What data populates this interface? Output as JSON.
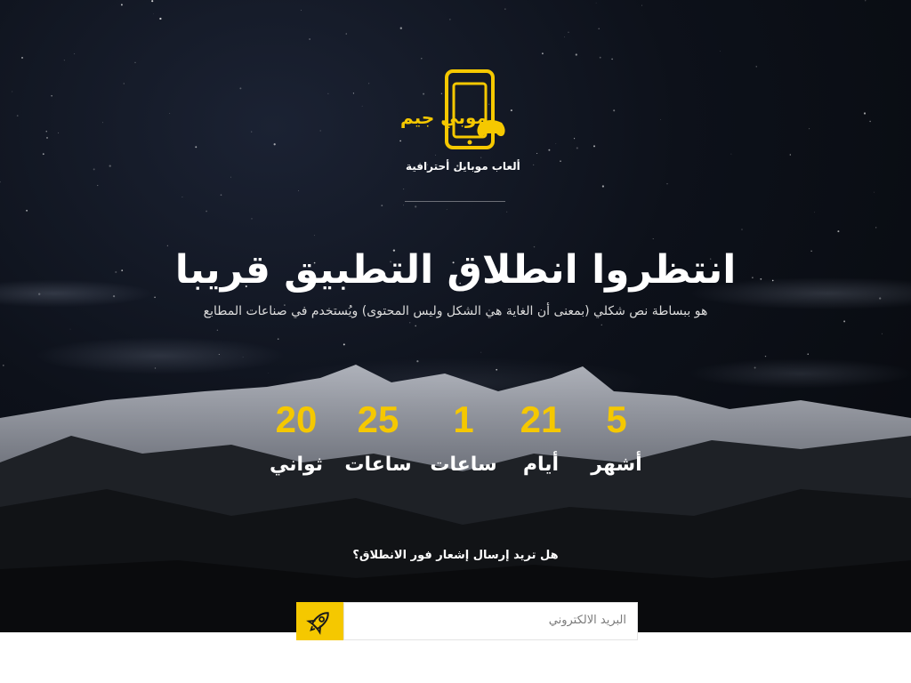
{
  "logo": {
    "brand_name": "موبي جيم",
    "tagline": "ألعاب موبايل أحترافية",
    "icon": "phone-gamepad-icon"
  },
  "hero": {
    "title": "انتظروا انطلاق التطبيق قريبا",
    "subtitle": "هو ببساطة نص شكلي (بمعنى أن الغاية هي الشكل وليس المحتوى) ويُستخدم في صناعات المطابع"
  },
  "countdown": [
    {
      "value": "5",
      "label": "أشهر"
    },
    {
      "value": "21",
      "label": "أيام"
    },
    {
      "value": "1",
      "label": "ساعات"
    },
    {
      "value": "25",
      "label": "ساعات"
    },
    {
      "value": "20",
      "label": "ثواني"
    }
  ],
  "notify": {
    "prompt": "هل تريد إرسال إشعار فور الانطلاق؟",
    "email_placeholder": "البريد الالكتروني",
    "submit_icon": "rocket-icon"
  },
  "colors": {
    "accent": "#f5c800",
    "background": "#0d111a"
  }
}
